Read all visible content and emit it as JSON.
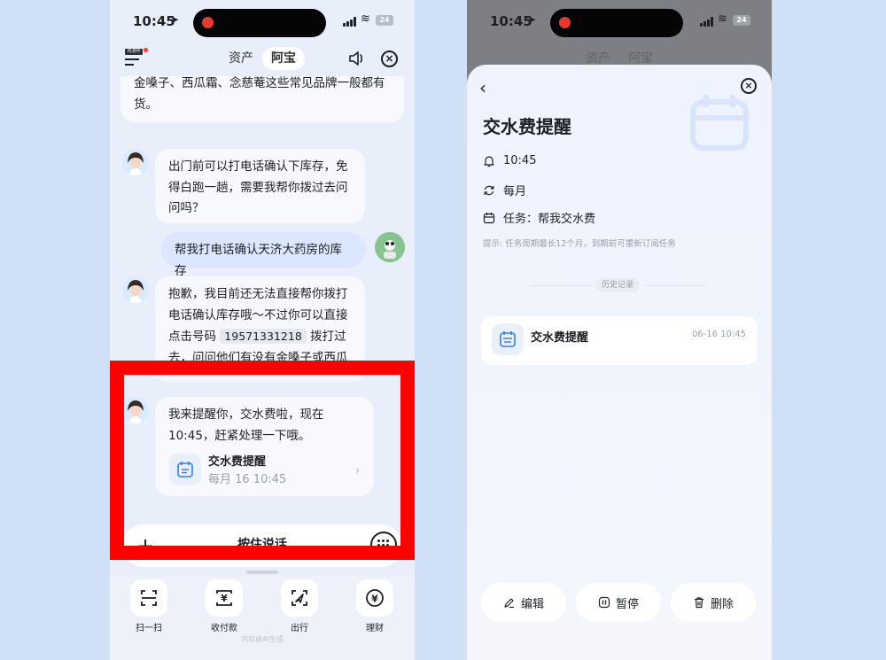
{
  "left_screen": {
    "status": {
      "time": "10:45",
      "battery": "24"
    },
    "header": {
      "badge": "内测中",
      "tabs": [
        {
          "label": "资产"
        },
        {
          "label": "阿宝"
        }
      ]
    },
    "chat": {
      "msg1": "金嗓子、西瓜霜、念慈菴这些常见品牌一般都有货。",
      "msg2": "出门前可以打电话确认下库存，免得白跑一趟，需要我帮你拨过去问问吗？",
      "msg3_user": "帮我打电话确认天济大药房的库存",
      "msg4_a": "抱歉，我目前还无法直接帮你拨打电话确认库存哦～不过你可以直接点击号码",
      "msg4_phone": "19571331218",
      "msg4_b": "拨打过去，问问他们有没有金嗓子或西瓜",
      "msg5": "我来提醒你，交水费啦，现在10:45，赶紧处理一下哦。",
      "reminder_card": {
        "title": "交水费提醒",
        "subtitle": "每月 16 10:45"
      }
    },
    "voice_bar": {
      "label": "按住说话"
    },
    "bottom_nav": [
      {
        "label": "扫一扫",
        "icon": "scan-icon"
      },
      {
        "label": "收付款",
        "icon": "payment-icon"
      },
      {
        "label": "出行",
        "icon": "travel-icon"
      },
      {
        "label": "理财",
        "icon": "finance-icon"
      }
    ],
    "ai_note": "内容由AI生成"
  },
  "right_screen": {
    "status": {
      "time": "10:45",
      "battery": "24"
    },
    "dim_tabs": [
      {
        "label": "资产"
      },
      {
        "label": "阿宝"
      }
    ],
    "title": "交水费提醒",
    "time": "10:45",
    "repeat": "每月",
    "task": "任务：帮我交水费",
    "tip": "提示: 任务周期最长12个月，到期前可重新订阅任务",
    "history_label": "历史记录",
    "history_item": {
      "title": "交水费提醒",
      "time": "06-16 10:45"
    },
    "actions": {
      "edit": "编辑",
      "pause": "暂停",
      "delete": "删除"
    }
  },
  "colors": {
    "accent_blue": "#3a7bf0",
    "highlight_red": "#ff0000",
    "background": "#cfe0f7"
  }
}
